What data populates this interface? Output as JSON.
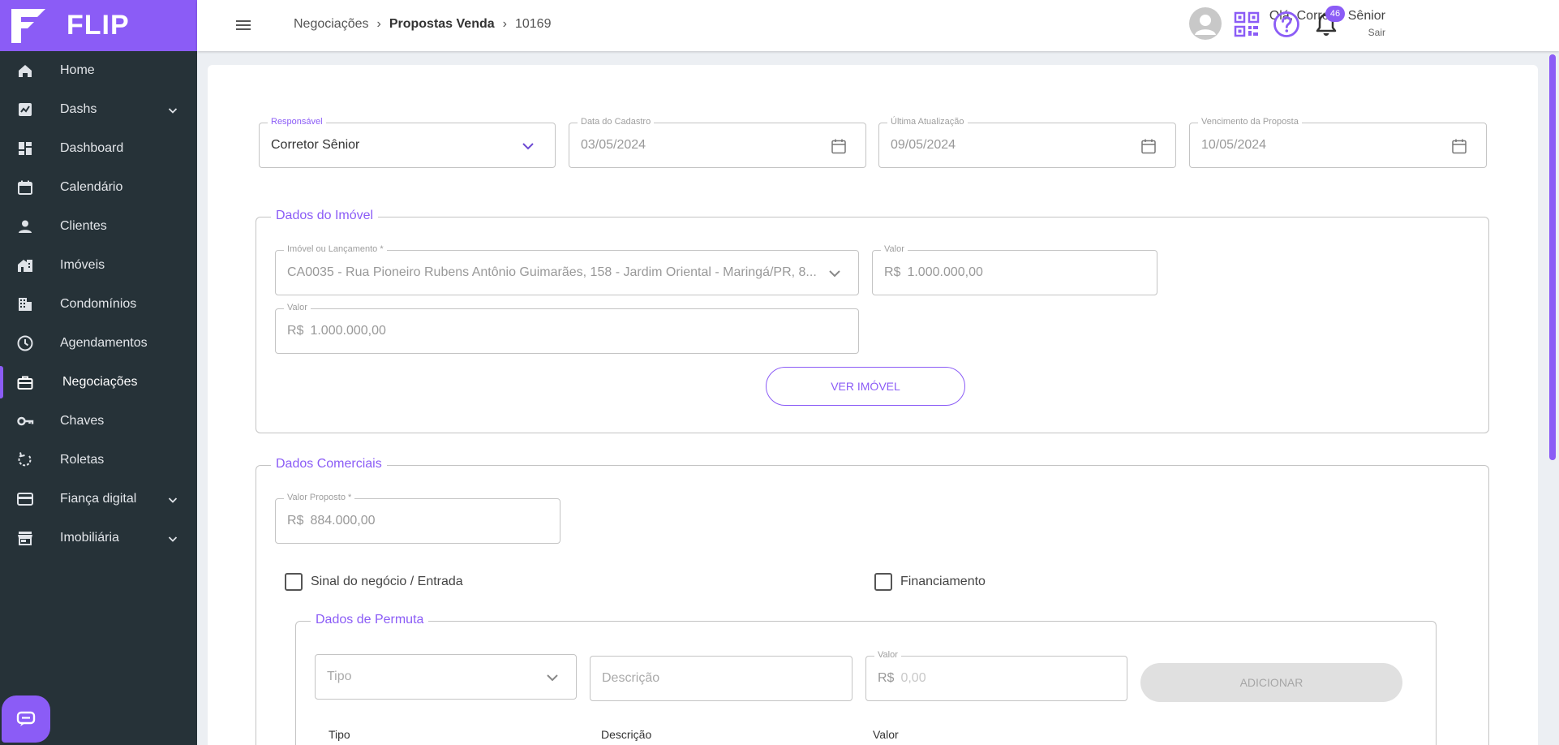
{
  "app": {
    "brand": "FLIP"
  },
  "sidebar": {
    "items": [
      {
        "label": "Home",
        "icon": "home-icon",
        "expandable": false
      },
      {
        "label": "Dashs",
        "icon": "chart-icon",
        "expandable": true
      },
      {
        "label": "Dashboard",
        "icon": "dashboard-icon",
        "expandable": false
      },
      {
        "label": "Calendário",
        "icon": "calendar-icon",
        "expandable": false
      },
      {
        "label": "Clientes",
        "icon": "person-icon",
        "expandable": false
      },
      {
        "label": "Imóveis",
        "icon": "house-icon",
        "expandable": false
      },
      {
        "label": "Condomínios",
        "icon": "building-icon",
        "expandable": false
      },
      {
        "label": "Agendamentos",
        "icon": "clock-icon",
        "expandable": false
      },
      {
        "label": "Negociações",
        "icon": "briefcase-icon",
        "expandable": false,
        "active": true
      },
      {
        "label": "Chaves",
        "icon": "key-icon",
        "expandable": false
      },
      {
        "label": "Roletas",
        "icon": "rotate-icon",
        "expandable": false
      },
      {
        "label": "Fiança digital",
        "icon": "card-icon",
        "expandable": true
      },
      {
        "label": "Imobiliária",
        "icon": "store-icon",
        "expandable": true
      }
    ]
  },
  "header": {
    "breadcrumb": [
      "Negociações",
      "Propostas Venda",
      "10169"
    ],
    "greeting": "Olá, Corretor Sênior",
    "logout": "Sair",
    "notifications": "46"
  },
  "form": {
    "responsavel": {
      "label": "Responsável",
      "value": "Corretor Sênior"
    },
    "data_cadastro": {
      "label": "Data do Cadastro",
      "value": "03/05/2024"
    },
    "ultima_atualizacao": {
      "label": "Última Atualização",
      "value": "09/05/2024"
    },
    "vencimento": {
      "label": "Vencimento da Proposta",
      "value": "10/05/2024"
    },
    "imovel_section": {
      "title": "Dados do Imóvel",
      "imovel": {
        "label": "Imóvel ou Lançamento *",
        "value": "CA0035 - Rua Pioneiro Rubens Antônio Guimarães, 158 - Jardim Oriental - Maringá/PR, 8..."
      },
      "valor1": {
        "label": "Valor",
        "prefix": "R$",
        "value": "1.000.000,00"
      },
      "valor2": {
        "label": "Valor",
        "prefix": "R$",
        "value": "1.000.000,00"
      },
      "ver_imovel": "VER IMÓVEL"
    },
    "comercial_section": {
      "title": "Dados Comerciais",
      "valor_proposto": {
        "label": "Valor Proposto *",
        "prefix": "R$",
        "value": "884.000,00"
      },
      "sinal": "Sinal do negócio / Entrada",
      "financiamento": "Financiamento"
    },
    "permuta_section": {
      "title": "Dados de Permuta",
      "tipo_placeholder": "Tipo",
      "descricao_placeholder": "Descrição",
      "valor": {
        "label": "Valor",
        "prefix": "R$",
        "placeholder": "0,00"
      },
      "adicionar": "ADICIONAR",
      "columns": [
        "Tipo",
        "Descrição",
        "Valor"
      ]
    }
  },
  "colors": {
    "accent": "#8b5cf6",
    "sidebar": "#263238"
  }
}
